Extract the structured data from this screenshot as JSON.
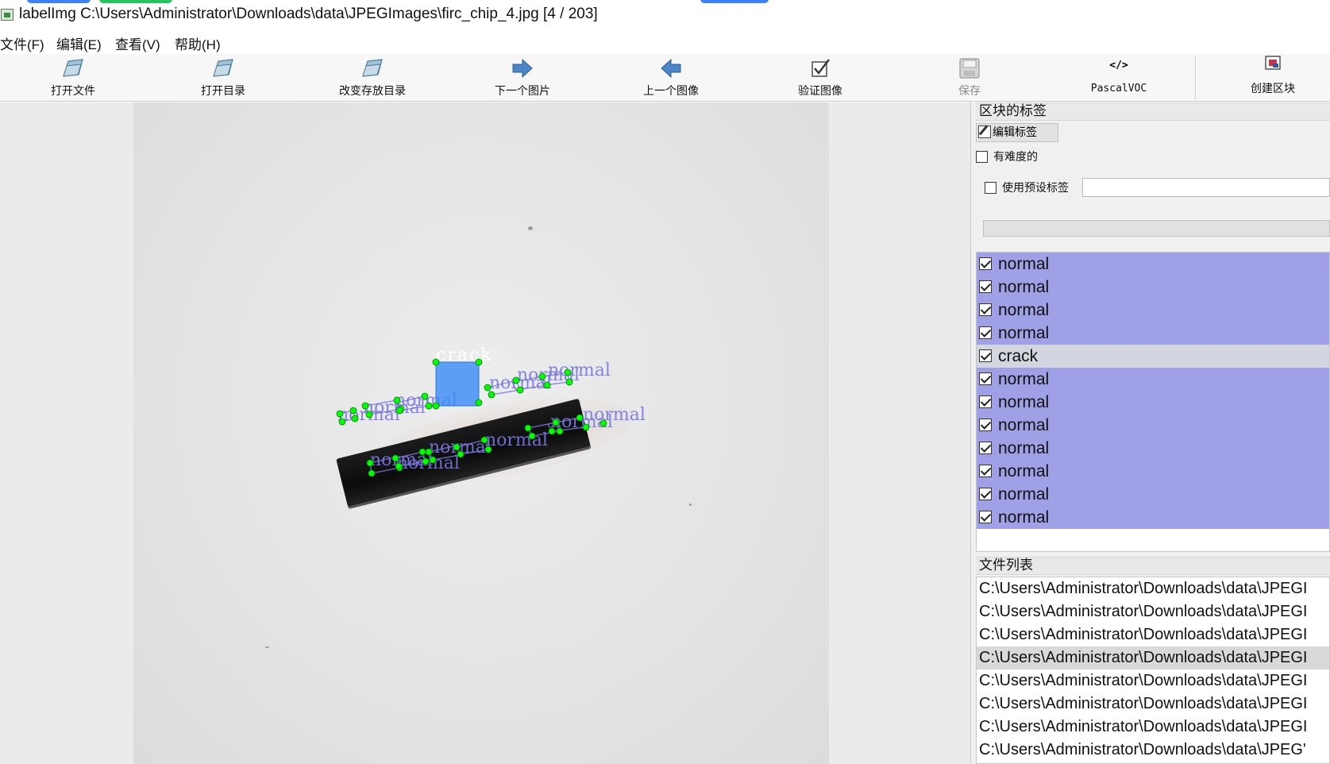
{
  "window": {
    "title": "labelImg C:\\Users\\Administrator\\Downloads\\data\\JPEGImages\\firc_chip_4.jpg [4 / 203]"
  },
  "menu": {
    "items": [
      "文件(F)",
      "编辑(E)",
      "查看(V)",
      "帮助(H)"
    ]
  },
  "toolbar": {
    "open_file": "打开文件",
    "open_dir": "打开目录",
    "change_save_dir": "改变存放目录",
    "next_image": "下一个图片",
    "prev_image": "上一个图像",
    "verify_image": "验证图像",
    "save": "保存",
    "format": "PascalVOC",
    "format_icon_text": "</>",
    "create_box": "创建区块"
  },
  "canvas": {
    "image_file": "firc_chip_4.jpg",
    "shapes": {
      "crack_label": "crack",
      "normal_label": "normal",
      "fill_color": "#3c8cf5",
      "vertex_color": "#00ff00",
      "outline_color": "#7a78e0"
    }
  },
  "box_labels_dock": {
    "title": "区块的标签",
    "edit_label_button": "编辑标签",
    "difficult_checkbox": "有难度的",
    "difficult_checked": false,
    "use_default_label_checkbox": "使用预设标签",
    "use_default_label_checked": false,
    "default_label_value": "",
    "labels": [
      {
        "text": "normal",
        "checked": true,
        "selected": false
      },
      {
        "text": "normal",
        "checked": true,
        "selected": false
      },
      {
        "text": "normal",
        "checked": true,
        "selected": false
      },
      {
        "text": "normal",
        "checked": true,
        "selected": false
      },
      {
        "text": "crack",
        "checked": true,
        "selected": true
      },
      {
        "text": "normal",
        "checked": true,
        "selected": false
      },
      {
        "text": "normal",
        "checked": true,
        "selected": false
      },
      {
        "text": "normal",
        "checked": true,
        "selected": false
      },
      {
        "text": "normal",
        "checked": true,
        "selected": false
      },
      {
        "text": "normal",
        "checked": true,
        "selected": false
      },
      {
        "text": "normal",
        "checked": true,
        "selected": false
      },
      {
        "text": "normal",
        "checked": true,
        "selected": false
      }
    ],
    "label_color": "#a0a0e6",
    "selected_color": "#d3d6de"
  },
  "file_list_dock": {
    "title": "文件列表",
    "files": [
      {
        "path": "C:\\Users\\Administrator\\Downloads\\data\\JPEGI",
        "selected": false
      },
      {
        "path": "C:\\Users\\Administrator\\Downloads\\data\\JPEGI",
        "selected": false
      },
      {
        "path": "C:\\Users\\Administrator\\Downloads\\data\\JPEGI",
        "selected": false
      },
      {
        "path": "C:\\Users\\Administrator\\Downloads\\data\\JPEGI",
        "selected": true
      },
      {
        "path": "C:\\Users\\Administrator\\Downloads\\data\\JPEGI",
        "selected": false
      },
      {
        "path": "C:\\Users\\Administrator\\Downloads\\data\\JPEGI",
        "selected": false
      },
      {
        "path": "C:\\Users\\Administrator\\Downloads\\data\\JPEGI",
        "selected": false
      },
      {
        "path": "C:\\Users\\Administrator\\Downloads\\data\\JPEG'",
        "selected": false
      }
    ]
  }
}
